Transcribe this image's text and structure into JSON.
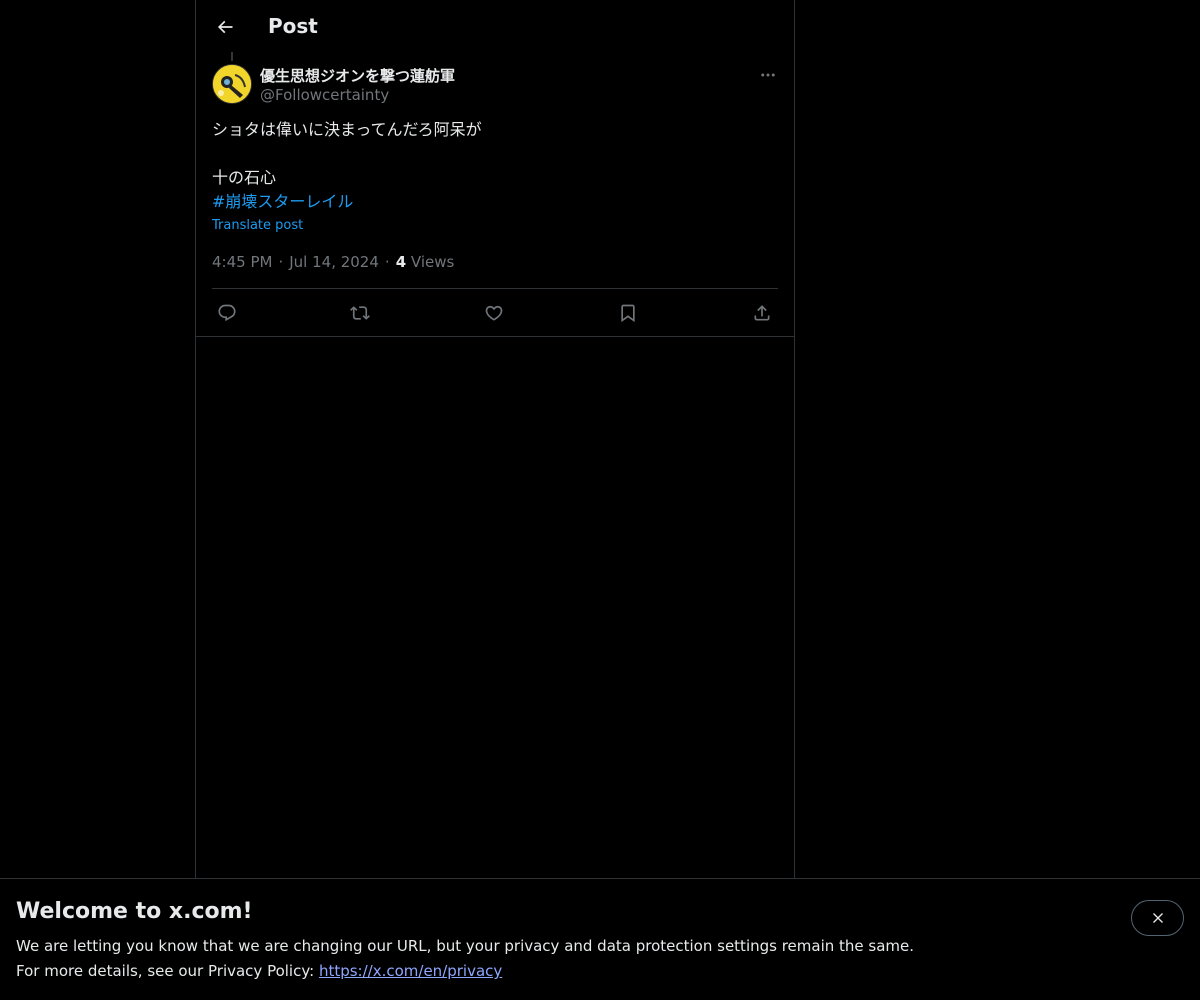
{
  "header": {
    "title": "Post",
    "back_icon": "arrow-left-icon"
  },
  "post": {
    "author": {
      "display_name": "優生思想ジオンを撃つ蓮舫軍",
      "handle": "@Followcertainty",
      "avatar_colors": {
        "background": "#f2d52a"
      }
    },
    "text_lines": [
      "ショタは偉いに決まってんだろ阿呆が",
      "",
      "十の石心"
    ],
    "hashtag": "#崩壊スターレイル",
    "translate_label": "Translate post",
    "time": "4:45 PM",
    "date": "Jul 14, 2024",
    "separator": "·",
    "views_count": "4",
    "views_label": "Views",
    "actions": [
      "reply-icon",
      "repost-icon",
      "like-icon",
      "bookmark-icon",
      "share-icon"
    ]
  },
  "banner": {
    "title": "Welcome to x.com!",
    "line1": "We are letting you know that we are changing our URL, but your privacy and data protection settings remain the same.",
    "line2_prefix": "For more details, see our Privacy Policy: ",
    "link": "https://x.com/en/privacy"
  },
  "colors": {
    "background": "#000000",
    "text": "#e7e9ea",
    "secondary": "#71767b",
    "accent": "#1d9bf0",
    "border": "#2f3336",
    "link": "#8fa6ff"
  }
}
